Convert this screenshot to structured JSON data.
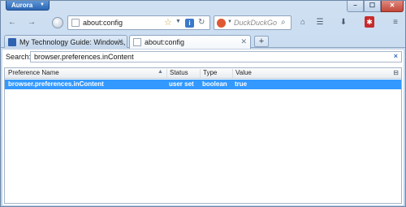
{
  "app": {
    "menu_label": "Aurora"
  },
  "window_controls": {
    "minimize": "–",
    "maximize": "☐",
    "close": "✕"
  },
  "navbar": {
    "back_glyph": "←",
    "forward_glyph": "→",
    "url": "about:config",
    "search_placeholder": "DuckDuckGo"
  },
  "tabs": [
    {
      "title": "My Technology Guide: Windows, Ma..."
    },
    {
      "title": "about:config"
    }
  ],
  "newtab_label": "+",
  "config": {
    "search_label": "Search:",
    "search_value": "browser.preferences.inContent",
    "clear_label": "×",
    "columns": [
      "Preference Name",
      "Status",
      "Type",
      "Value"
    ],
    "rows": [
      {
        "name": "browser.preferences.inContent",
        "status": "user set",
        "type": "boolean",
        "value": "true"
      }
    ]
  },
  "colors": {
    "selection": "#3399ff",
    "chrome": "#c9dcef",
    "appmenu": "#2c66b4"
  }
}
